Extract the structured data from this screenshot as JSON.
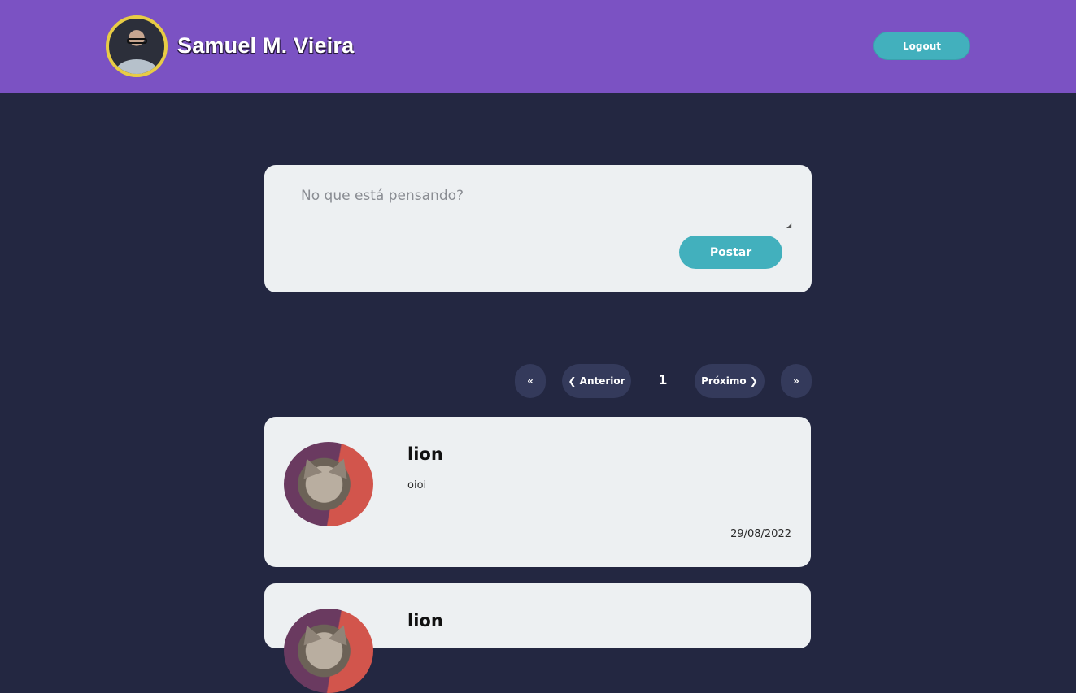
{
  "header": {
    "user_name": "Samuel M. Vieira",
    "logout_label": "Logout",
    "accent_color": "#7b52c3"
  },
  "composer": {
    "placeholder": "No que está pensando?",
    "post_label": "Postar",
    "button_color": "#42b0bd"
  },
  "pagination": {
    "first_label": "«",
    "prev_label": "❮ Anterior",
    "current_page": "1",
    "next_label": "Próximo ❯",
    "last_label": "»"
  },
  "posts": [
    {
      "author": "lion",
      "text": "oioi",
      "date": "29/08/2022",
      "avatar_icon": "cat-avatar"
    },
    {
      "author": "lion",
      "text": "",
      "date": "",
      "avatar_icon": "cat-avatar"
    }
  ]
}
